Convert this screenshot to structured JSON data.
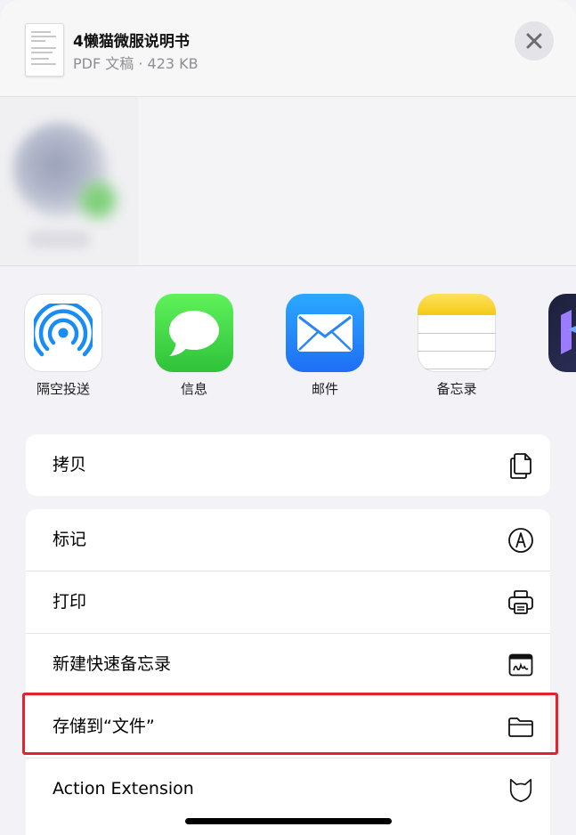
{
  "header": {
    "title": "4懒猫微服说明书",
    "subtitle": "PDF 文稿 · 423 KB"
  },
  "apps": [
    {
      "label": "隔空投送",
      "icon": "airdrop-icon"
    },
    {
      "label": "信息",
      "icon": "messages-icon"
    },
    {
      "label": "邮件",
      "icon": "mail-icon"
    },
    {
      "label": "备忘录",
      "icon": "notes-icon"
    },
    {
      "label": "",
      "icon": "app-icon-partial"
    }
  ],
  "group1": [
    {
      "label": "拷贝",
      "icon": "copy-icon"
    }
  ],
  "group2": [
    {
      "label": "标记",
      "icon": "markup-icon"
    },
    {
      "label": "打印",
      "icon": "printer-icon"
    },
    {
      "label": "新建快速备忘录",
      "icon": "quick-note-icon"
    },
    {
      "label": "存储到“文件”",
      "icon": "folder-icon"
    },
    {
      "label": "Action Extension",
      "icon": "cat-icon"
    }
  ],
  "colors": {
    "highlight": "#e3222b",
    "background": "#f2f2f7"
  }
}
